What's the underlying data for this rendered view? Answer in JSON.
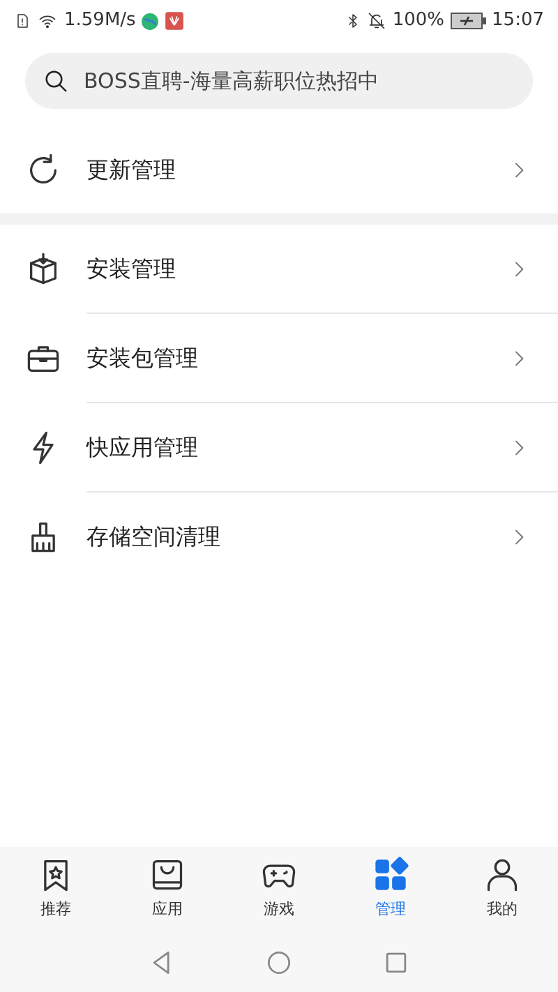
{
  "status_bar": {
    "speed": "1.59M/s",
    "battery": "100%",
    "time": "15:07"
  },
  "search": {
    "placeholder": "BOSS直聘-海量高薪职位热招中"
  },
  "sections": [
    {
      "items": [
        {
          "label": "更新管理"
        }
      ]
    },
    {
      "items": [
        {
          "label": "安装管理"
        },
        {
          "label": "安装包管理"
        },
        {
          "label": "快应用管理"
        },
        {
          "label": "存储空间清理"
        }
      ]
    }
  ],
  "tabs": [
    {
      "label": "推荐",
      "selected": false
    },
    {
      "label": "应用",
      "selected": false
    },
    {
      "label": "游戏",
      "selected": false
    },
    {
      "label": "管理",
      "selected": true
    },
    {
      "label": "我的",
      "selected": false
    }
  ]
}
